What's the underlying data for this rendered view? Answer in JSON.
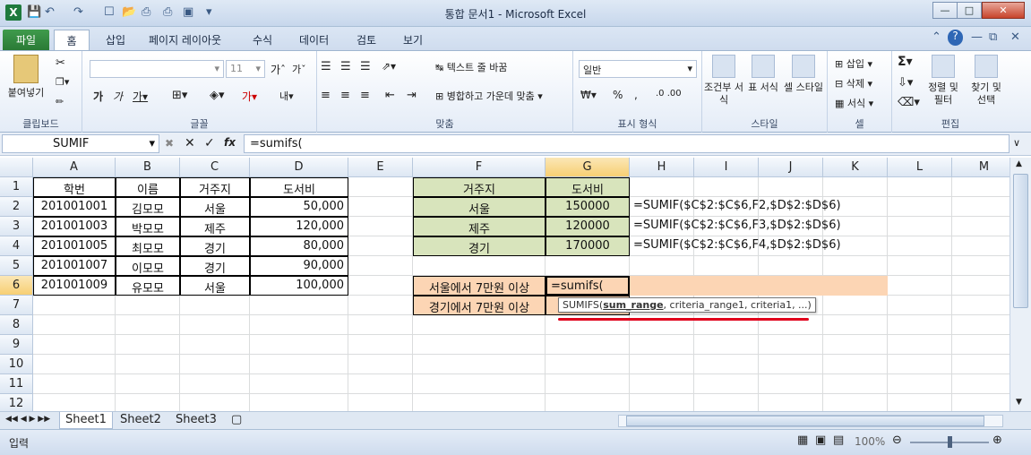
{
  "window": {
    "title": "통합 문서1 - Microsoft Excel"
  },
  "tabs": [
    "파일",
    "홈",
    "삽입",
    "페이지 레이아웃",
    "수식",
    "데이터",
    "검토",
    "보기"
  ],
  "ribbon": {
    "paste_label": "붙여넣기",
    "clipboard_label": "클립보드",
    "font_label": "글꼴",
    "font_size": "11",
    "align_label": "맞춤",
    "wrap_text": "텍스트 줄 바꿈",
    "merge_center": "병합하고 가운데 맞춤",
    "number_format": "일반",
    "number_label": "표시 형식",
    "cond_format": "조건부 서식",
    "table_format": "표 서식",
    "cell_style": "셀 스타일",
    "style_label": "스타일",
    "insert": "삽입",
    "delete": "삭제",
    "format": "서식",
    "cells_label": "셀",
    "sort_filter": "정렬 및 필터",
    "find_select": "찾기 및 선택",
    "edit_label": "편집"
  },
  "formula_bar": {
    "name_box": "SUMIF",
    "fx": "fx",
    "formula": "=sumifs("
  },
  "columns": [
    "A",
    "B",
    "C",
    "D",
    "E",
    "F",
    "G",
    "H",
    "I",
    "J",
    "K",
    "L",
    "M"
  ],
  "rows": [
    "1",
    "2",
    "3",
    "4",
    "5",
    "6",
    "7",
    "8",
    "9",
    "10",
    "11",
    "12"
  ],
  "table1": {
    "headers": [
      "학번",
      "이름",
      "거주지",
      "도서비"
    ],
    "rows": [
      [
        "201001001",
        "김모모",
        "서울",
        "50,000"
      ],
      [
        "201001003",
        "박모모",
        "제주",
        "120,000"
      ],
      [
        "201001005",
        "최모모",
        "경기",
        "80,000"
      ],
      [
        "201001007",
        "이모모",
        "경기",
        "90,000"
      ],
      [
        "201001009",
        "유모모",
        "서울",
        "100,000"
      ]
    ]
  },
  "table2": {
    "headers": [
      "거주지",
      "도서비"
    ],
    "rows": [
      [
        "서울",
        "150000"
      ],
      [
        "제주",
        "120000"
      ],
      [
        "경기",
        "170000"
      ]
    ],
    "formulas": [
      "=SUMIF($C$2:$C$6,F2,$D$2:$D$6)",
      "=SUMIF($C$2:$C$6,F3,$D$2:$D$6)",
      "=SUMIF($C$2:$C$6,F4,$D$2:$D$6)"
    ]
  },
  "labels": {
    "f6": "서울에서 7만원 이상",
    "f7": "경기에서 7만원 이상",
    "g6": "=sumifs("
  },
  "tooltip": {
    "fn": "SUMIFS(",
    "bold_arg": "sum_range",
    "rest": ", criteria_range1, criteria1, ...)"
  },
  "sheets": [
    "Sheet1",
    "Sheet2",
    "Sheet3"
  ],
  "status": {
    "mode": "입력",
    "zoom": "100%"
  },
  "colors": {
    "green_fill": "#d8e4bc",
    "orange_fill": "#fcd5b4",
    "accent": "#2a7a36",
    "underline": "#e0001b"
  }
}
